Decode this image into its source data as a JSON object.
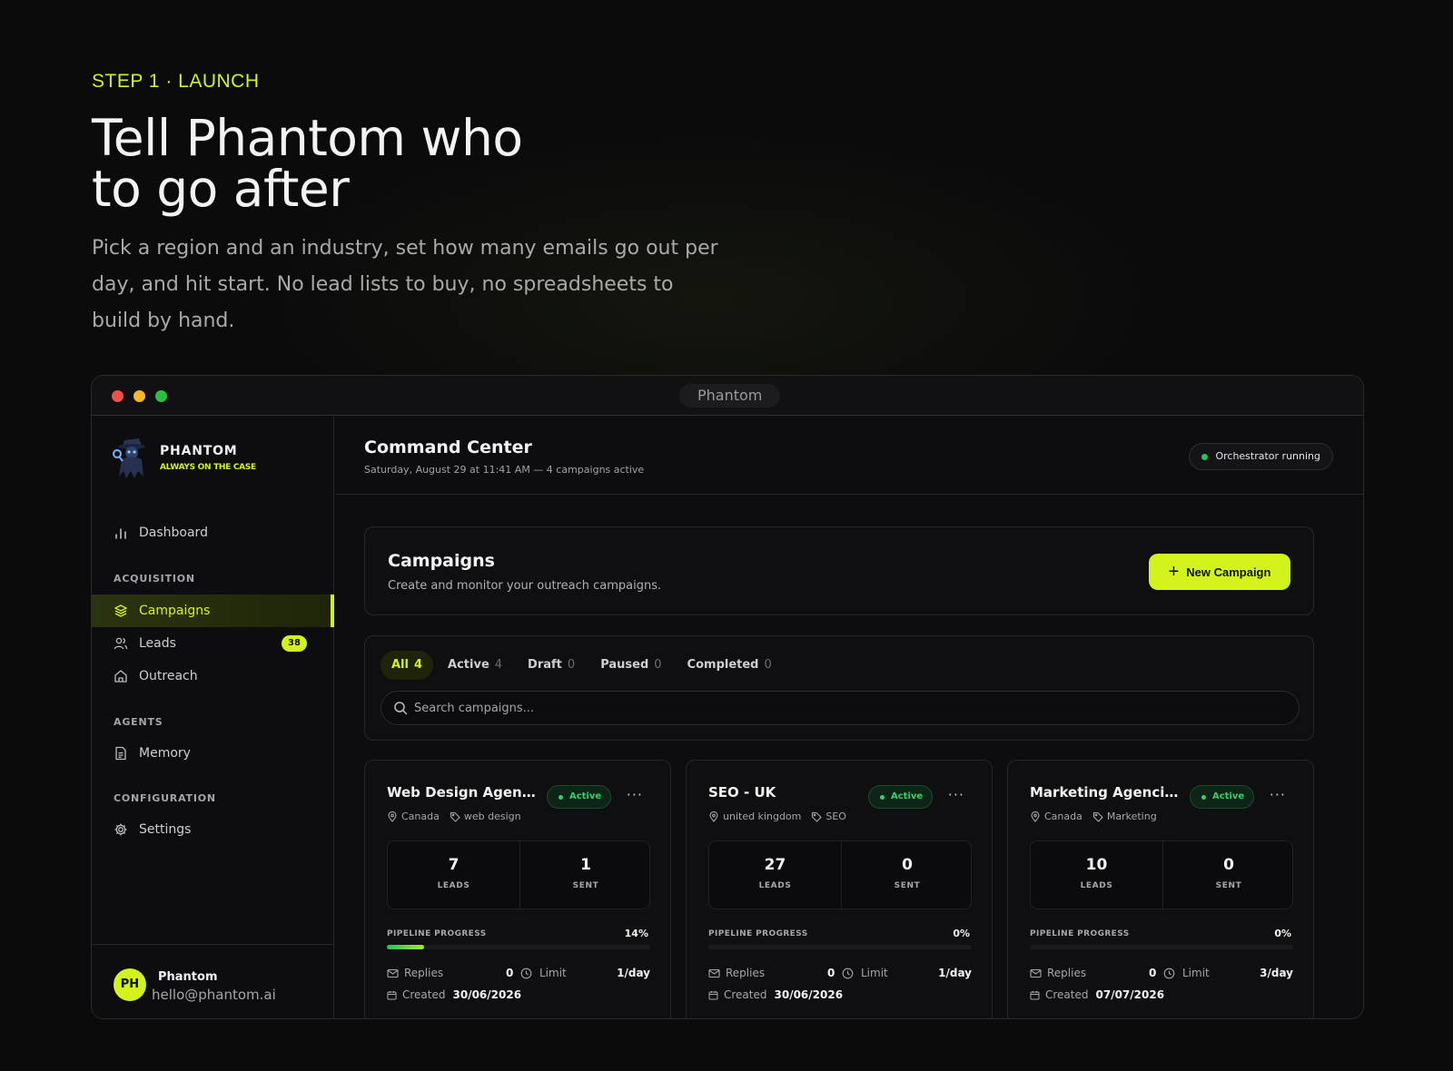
{
  "hero": {
    "eyebrow": "STEP 1 · LAUNCH",
    "headline_line1": "Tell Phantom who",
    "headline_line2": "to go after",
    "subtext": "Pick a region and an industry, set how many emails go out per day, and hit start. No lead lists to buy, no spreadsheets to build by hand."
  },
  "window": {
    "title": "Phantom"
  },
  "sidebar": {
    "brand_name": "PHANTOM",
    "brand_tagline": "ALWAYS ON THE CASE",
    "dashboard": "Dashboard",
    "section_acquisition": "ACQUISITION",
    "campaigns": "Campaigns",
    "leads": "Leads",
    "leads_count": "38",
    "outreach": "Outreach",
    "section_agents": "AGENTS",
    "memory": "Memory",
    "section_configuration": "CONFIGURATION",
    "settings": "Settings",
    "user": {
      "initials": "PH",
      "name": "Phantom",
      "email": "hello@phantom.ai"
    }
  },
  "topbar": {
    "title": "Command Center",
    "subtitle": "Saturday, August 29 at 11:41 AM — 4 campaigns active",
    "status": "Orchestrator running"
  },
  "campaigns_header": {
    "title": "Campaigns",
    "subtitle": "Create and monitor your outreach campaigns.",
    "new_button": "New Campaign"
  },
  "filters": {
    "tabs": [
      {
        "label": "All",
        "count": "4"
      },
      {
        "label": "Active",
        "count": "4"
      },
      {
        "label": "Draft",
        "count": "0"
      },
      {
        "label": "Paused",
        "count": "0"
      },
      {
        "label": "Completed",
        "count": "0"
      }
    ],
    "search_placeholder": "Search campaigns..."
  },
  "colors": {
    "accent": "#d4f21c",
    "status_green": "#2fd36b",
    "background": "#0b0b0c"
  },
  "cards": [
    {
      "name": "Web Design Agen...",
      "status": "Active",
      "more": "···",
      "region": "Canada",
      "industry": "web design",
      "leads": "7",
      "leads_label": "LEADS",
      "sent": "1",
      "sent_label": "SENT",
      "progress_label": "PIPELINE PROGRESS",
      "progress": "14%",
      "progress_fraction": 0.14,
      "replies_label": "Replies",
      "replies": "0",
      "limit_label": "Limit",
      "limit": "1/day",
      "created_label": "Created",
      "created": "30/06/2026"
    },
    {
      "name": "SEO - UK",
      "status": "Active",
      "more": "···",
      "region": "united kingdom",
      "industry": "SEO",
      "leads": "27",
      "leads_label": "LEADS",
      "sent": "0",
      "sent_label": "SENT",
      "progress_label": "PIPELINE PROGRESS",
      "progress": "0%",
      "progress_fraction": 0,
      "replies_label": "Replies",
      "replies": "0",
      "limit_label": "Limit",
      "limit": "1/day",
      "created_label": "Created",
      "created": "30/06/2026"
    },
    {
      "name": "Marketing Agenci...",
      "status": "Active",
      "more": "···",
      "region": "Canada",
      "industry": "Marketing",
      "leads": "10",
      "leads_label": "LEADS",
      "sent": "0",
      "sent_label": "SENT",
      "progress_label": "PIPELINE PROGRESS",
      "progress": "0%",
      "progress_fraction": 0,
      "replies_label": "Replies",
      "replies": "0",
      "limit_label": "Limit",
      "limit": "3/day",
      "created_label": "Created",
      "created": "07/07/2026"
    }
  ]
}
